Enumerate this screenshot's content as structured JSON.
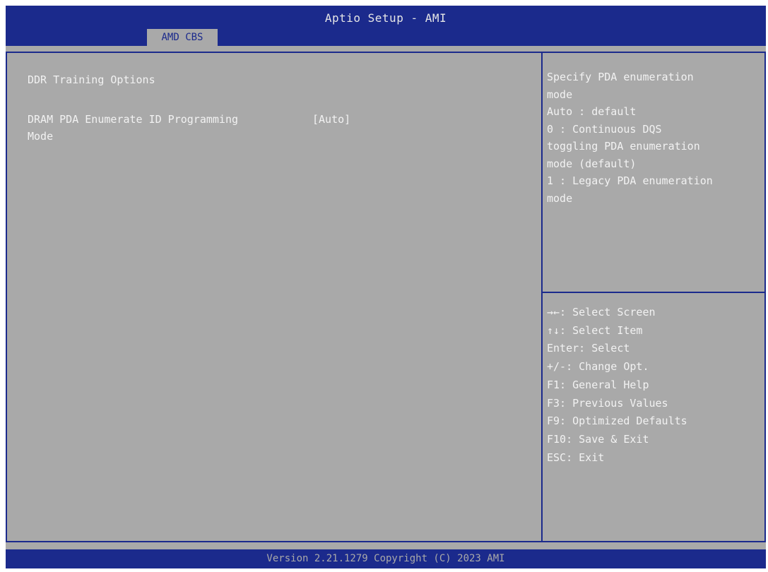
{
  "header": {
    "title": "Aptio Setup - AMI",
    "tabs": [
      "AMD CBS"
    ]
  },
  "main": {
    "heading": "DDR Training Options",
    "setting": {
      "label_lines": [
        "DRAM PDA Enumerate ID Programming",
        "Mode"
      ],
      "value": "[Auto]"
    }
  },
  "help": {
    "lines": [
      "Specify PDA enumeration",
      "mode",
      "Auto : default",
      "0 : Continuous DQS",
      "toggling PDA enumeration",
      "mode (default)",
      "1 : Legacy PDA enumeration",
      "mode"
    ]
  },
  "keys": {
    "lines": [
      "→←: Select Screen",
      "↑↓: Select Item",
      "Enter: Select",
      "+/-: Change Opt.",
      "F1: General Help",
      "F3: Previous Values",
      "F9: Optimized Defaults",
      "F10: Save & Exit",
      "ESC: Exit"
    ]
  },
  "footer": {
    "text": "Version 2.21.1279 Copyright (C) 2023 AMI"
  },
  "colors": {
    "frame_blue": "#1b2a8c",
    "background_gray": "#a9a9a9",
    "text_white": "#f2f2f2"
  }
}
